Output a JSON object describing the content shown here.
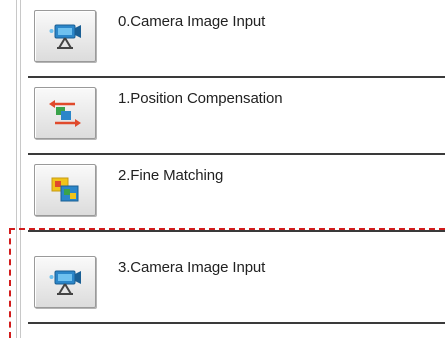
{
  "steps": [
    {
      "label": "0.Camera Image Input",
      "icon": "camera-icon"
    },
    {
      "label": "1.Position Compensation",
      "icon": "position-compensation-icon"
    },
    {
      "label": "2.Fine Matching",
      "icon": "fine-matching-icon"
    },
    {
      "label": "3.Camera Image Input",
      "icon": "camera-icon"
    }
  ],
  "colors": {
    "highlight": "#d21c1c",
    "divider": "#3a3a3a"
  }
}
